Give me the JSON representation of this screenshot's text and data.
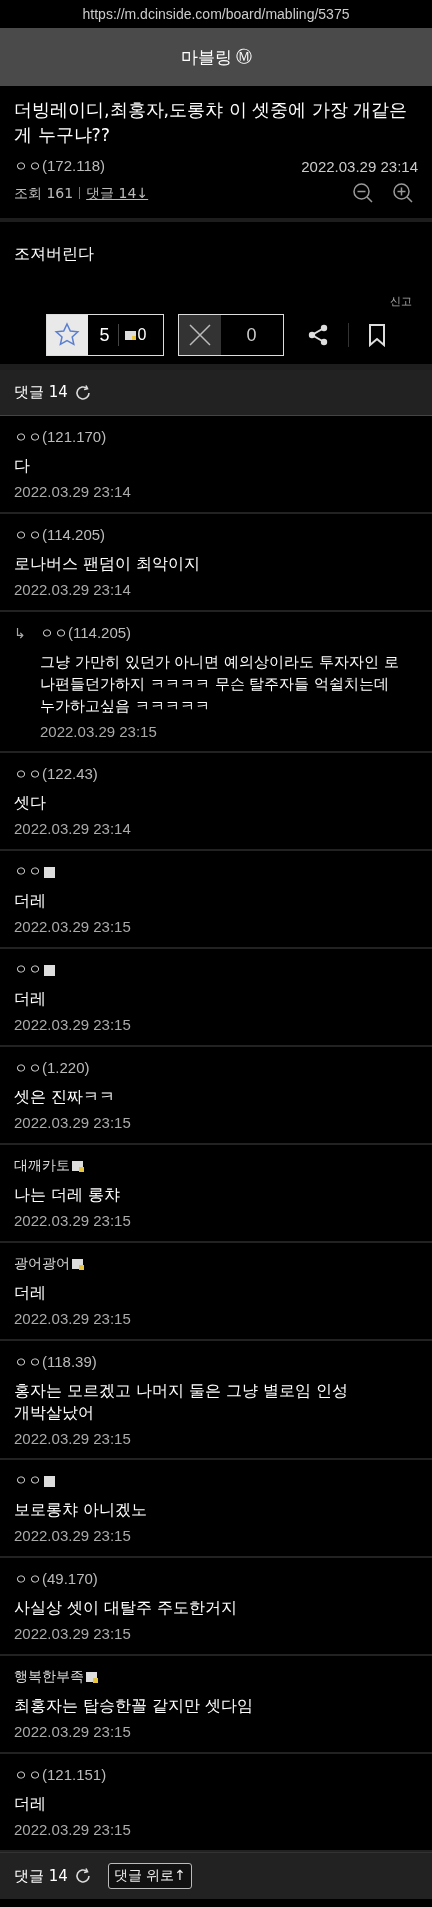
{
  "url": "https://m.dcinside.com/board/mabling/5375",
  "header": {
    "title": "마블링",
    "badge": "Ⓜ"
  },
  "post": {
    "title": "더빙레이디,최홍자,도롱챠 이 셋중에 가장 개같은게 누구냐??",
    "nick": "ㅇㅇ",
    "ip": "(172.118)",
    "date": "2022.03.29 23:14",
    "views": "조회 161",
    "comments_link": "댓글 14↓",
    "body": "조져버린다",
    "report": "신고",
    "recommend": {
      "up": "5",
      "fixed_up": "0",
      "down": "0"
    }
  },
  "comment_bar": {
    "label": "댓글 14"
  },
  "comments": [
    {
      "kind": "guest",
      "nick": "ㅇㅇ",
      "ip": "(121.170)",
      "text": "다",
      "date": "2022.03.29 23:14",
      "reply": false
    },
    {
      "kind": "guest",
      "nick": "ㅇㅇ",
      "ip": "(114.205)",
      "text": "로나버스 팬덤이 최악이지",
      "date": "2022.03.29 23:14",
      "reply": false
    },
    {
      "kind": "guest",
      "nick": "ㅇㅇ",
      "ip": "(114.205)",
      "text": "그냥 가만히 있던가 아니면 예의상이라도 투자자인 로나편들던가하지 ㅋㅋㅋㅋ 무슨 탈주자들 억쉴치는데 누가하고싶음 ㅋㅋㅋㅋㅋ",
      "date": "2022.03.29 23:15",
      "reply": true,
      "reply_mark": "↳"
    },
    {
      "kind": "guest",
      "nick": "ㅇㅇ",
      "ip": "(122.43)",
      "text": "셋다",
      "date": "2022.03.29 23:14",
      "reply": false
    },
    {
      "kind": "semi",
      "nick": "ㅇㅇ",
      "text": "더레",
      "date": "2022.03.29 23:15",
      "reply": false
    },
    {
      "kind": "semi",
      "nick": "ㅇㅇ",
      "text": "더레",
      "date": "2022.03.29 23:15",
      "reply": false
    },
    {
      "kind": "guest",
      "nick": "ㅇㅇ",
      "ip": "(1.220)",
      "text": "셋은 진짜ㅋㅋ",
      "date": "2022.03.29 23:15",
      "reply": false
    },
    {
      "kind": "member",
      "nick": "대깨카토",
      "text": "나는 더레 롱챠",
      "date": "2022.03.29 23:15",
      "reply": false
    },
    {
      "kind": "member",
      "nick": "광어광어",
      "text": "더레",
      "date": "2022.03.29 23:15",
      "reply": false
    },
    {
      "kind": "guest",
      "nick": "ㅇㅇ",
      "ip": "(118.39)",
      "text": "홍자는 모르겠고 나머지 둘은 그냥 별로임 인성 개박살났어",
      "date": "2022.03.29 23:15",
      "reply": false
    },
    {
      "kind": "semi",
      "nick": "ㅇㅇ",
      "text": "보로롱챠 아니겠노",
      "date": "2022.03.29 23:15",
      "reply": false
    },
    {
      "kind": "guest",
      "nick": "ㅇㅇ",
      "ip": "(49.170)",
      "text": "사실상 셋이 대탈주 주도한거지",
      "date": "2022.03.29 23:15",
      "reply": false
    },
    {
      "kind": "member",
      "nick": "행복한부족",
      "text": "최홍자는 탑승한꼴 같지만 셋다임",
      "date": "2022.03.29 23:15",
      "reply": false
    },
    {
      "kind": "guest",
      "nick": "ㅇㅇ",
      "ip": "(121.151)",
      "text": "더레",
      "date": "2022.03.29 23:15",
      "reply": false
    }
  ],
  "footer": {
    "label": "댓글 14",
    "top_button": "댓글 위로↑"
  }
}
